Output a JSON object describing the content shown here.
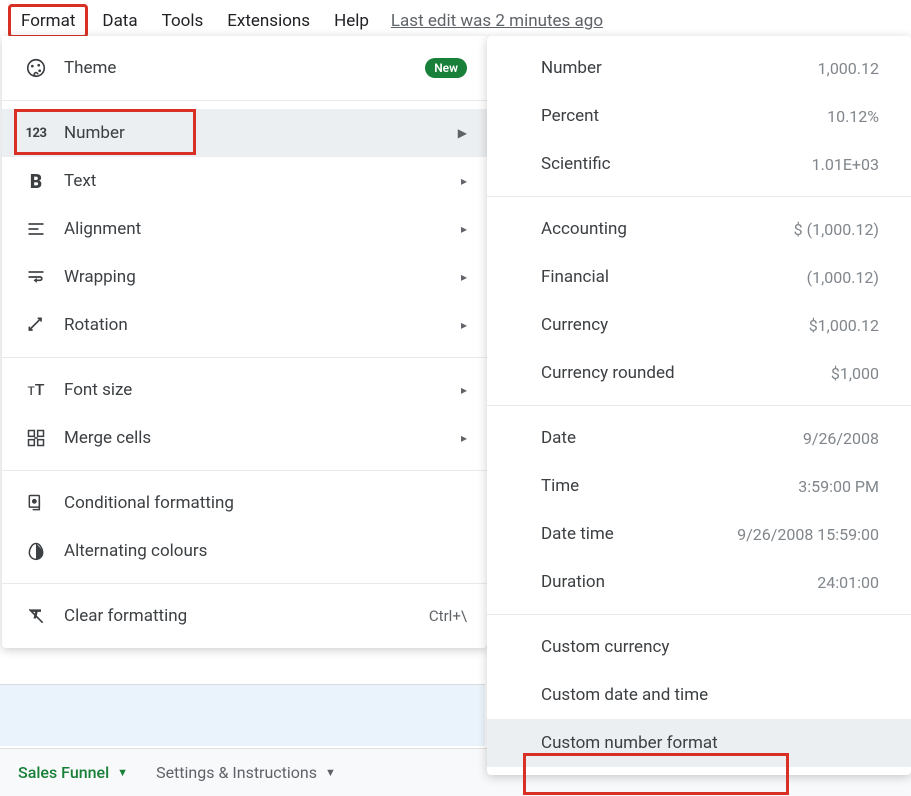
{
  "menubar": {
    "items": [
      "Format",
      "Data",
      "Tools",
      "Extensions",
      "Help"
    ],
    "last_edit": "Last edit was 2 minutes ago"
  },
  "format_menu": {
    "theme": {
      "label": "Theme",
      "badge": "New"
    },
    "number": {
      "label": "Number"
    },
    "text": {
      "label": "Text"
    },
    "alignment": {
      "label": "Alignment"
    },
    "wrapping": {
      "label": "Wrapping"
    },
    "rotation": {
      "label": "Rotation"
    },
    "font_size": {
      "label": "Font size"
    },
    "merge_cells": {
      "label": "Merge cells"
    },
    "conditional": {
      "label": "Conditional formatting"
    },
    "alternating": {
      "label": "Alternating colours"
    },
    "clear": {
      "label": "Clear formatting",
      "shortcut": "Ctrl+\\"
    }
  },
  "number_submenu": [
    {
      "label": "Number",
      "example": "1,000.12"
    },
    {
      "label": "Percent",
      "example": "10.12%"
    },
    {
      "label": "Scientific",
      "example": "1.01E+03"
    },
    null,
    {
      "label": "Accounting",
      "example": "$ (1,000.12)"
    },
    {
      "label": "Financial",
      "example": "(1,000.12)"
    },
    {
      "label": "Currency",
      "example": "$1,000.12"
    },
    {
      "label": "Currency rounded",
      "example": "$1,000"
    },
    null,
    {
      "label": "Date",
      "example": "9/26/2008"
    },
    {
      "label": "Time",
      "example": "3:59:00 PM"
    },
    {
      "label": "Date time",
      "example": "9/26/2008 15:59:00"
    },
    {
      "label": "Duration",
      "example": "24:01:00"
    },
    null,
    {
      "label": "Custom currency",
      "example": ""
    },
    {
      "label": "Custom date and time",
      "example": ""
    },
    {
      "label": "Custom number format",
      "example": ""
    }
  ],
  "tabs": {
    "active": "Sales Funnel",
    "inactive": "Settings & Instructions"
  }
}
